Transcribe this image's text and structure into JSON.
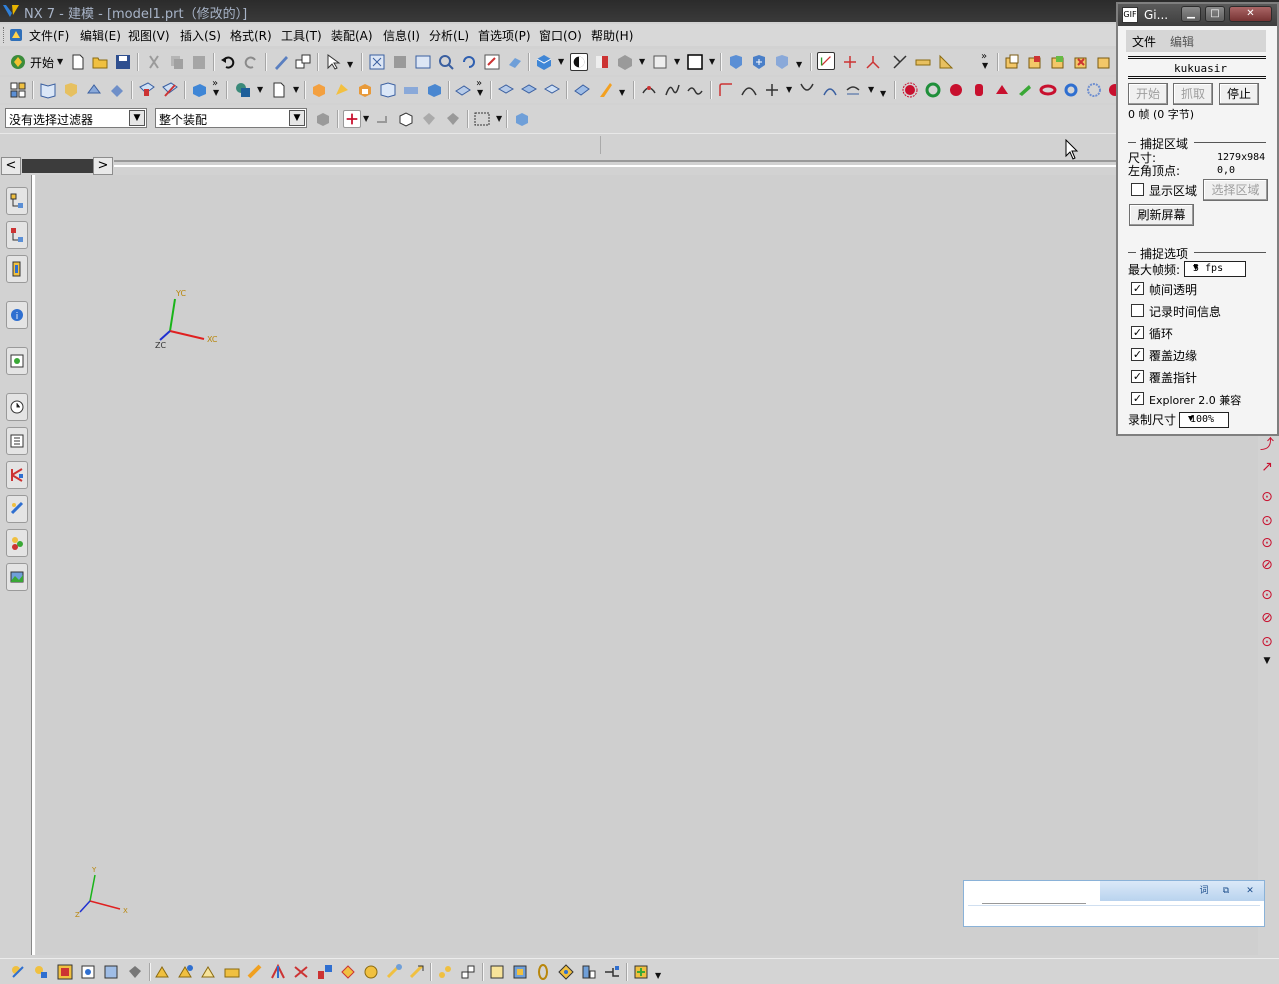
{
  "title_bar": {
    "text": "NX 7 - 建模 - [model1.prt（修改的）]"
  },
  "menu": [
    "文件(F)",
    "编辑(E)",
    "视图(V)",
    "插入(S)",
    "格式(R)",
    "工具(T)",
    "装配(A)",
    "信息(I)",
    "分析(L)",
    "首选项(P)",
    "窗口(O)",
    "帮助(H)"
  ],
  "toolbar1": {
    "start_label": "开始"
  },
  "selection_bar": {
    "filter_value": "没有选择过滤器",
    "scope_value": "整个装配"
  },
  "wcs_triad": {
    "x": "XC",
    "y": "YC",
    "z": "ZC"
  },
  "abs_triad": {
    "x": "X",
    "y": "Y",
    "z": "Z"
  },
  "capture_window": {
    "title": "Gi...",
    "menu": [
      "文件",
      "编辑"
    ],
    "user": "kukuasir",
    "buttons": {
      "start": "开始",
      "grab": "抓取",
      "stop": "停止"
    },
    "frames": "0 帧 (0 字节)",
    "capture_area": {
      "heading": "捕捉区域",
      "size_label": "尺寸:",
      "size_value": "1279x984",
      "corner_label": "左角顶点:",
      "corner_value": "0,0",
      "show_area": "显示区域",
      "show_area_checked": false,
      "select_area": "选择区域",
      "refresh": "刷新屏幕"
    },
    "capture_options": {
      "heading": "捕捉选项",
      "max_fps_label": "最大帧频:",
      "max_fps_value": "5 fps",
      "options": [
        {
          "label": "帧间透明",
          "checked": true
        },
        {
          "label": "记录时间信息",
          "checked": false
        },
        {
          "label": "循环",
          "checked": true
        },
        {
          "label": "覆盖边缘",
          "checked": true
        },
        {
          "label": "覆盖指针",
          "checked": true
        },
        {
          "label": "Explorer 2.0 兼容",
          "checked": true
        }
      ],
      "record_size_label": "录制尺寸",
      "record_size_value": "100%"
    }
  },
  "float_panel": {
    "btn1": "词",
    "btn2": "⧉",
    "btn3": "✕"
  },
  "colors": {
    "accent_red": "#c8102e",
    "title_bg": "#333333",
    "canvas_bg": "#cfcfcf"
  }
}
